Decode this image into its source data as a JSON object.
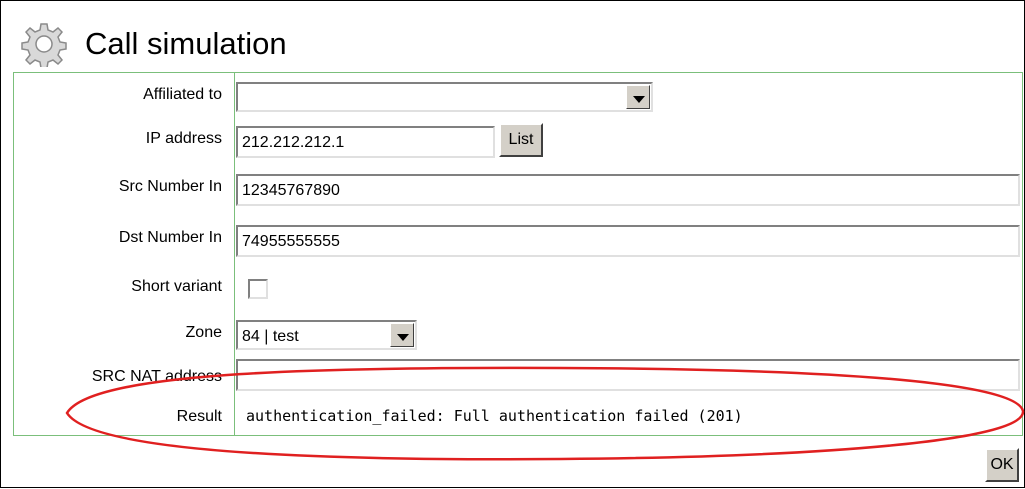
{
  "dialog": {
    "title": "Call simulation",
    "icon": "gear-icon"
  },
  "form": {
    "affiliated_to": {
      "label": "Affiliated to",
      "value": ""
    },
    "ip_address": {
      "label": "IP address",
      "value": "212.212.212.1",
      "list_button": "List"
    },
    "src_number_in": {
      "label": "Src Number In",
      "value": "12345767890"
    },
    "dst_number_in": {
      "label": "Dst Number In",
      "value": "74955555555"
    },
    "short_variant": {
      "label": "Short variant",
      "checked": false
    },
    "zone": {
      "label": "Zone",
      "value": "84 | test"
    },
    "src_nat_address": {
      "label": "SRC NAT address",
      "value": ""
    },
    "result": {
      "label": "Result",
      "value": "authentication_failed: Full authentication failed (201)"
    }
  },
  "actions": {
    "ok_label": "OK"
  },
  "colors": {
    "border_green": "#7bbf7b",
    "highlight_ellipse": "#e02020",
    "button_face": "#d4d0c8"
  }
}
